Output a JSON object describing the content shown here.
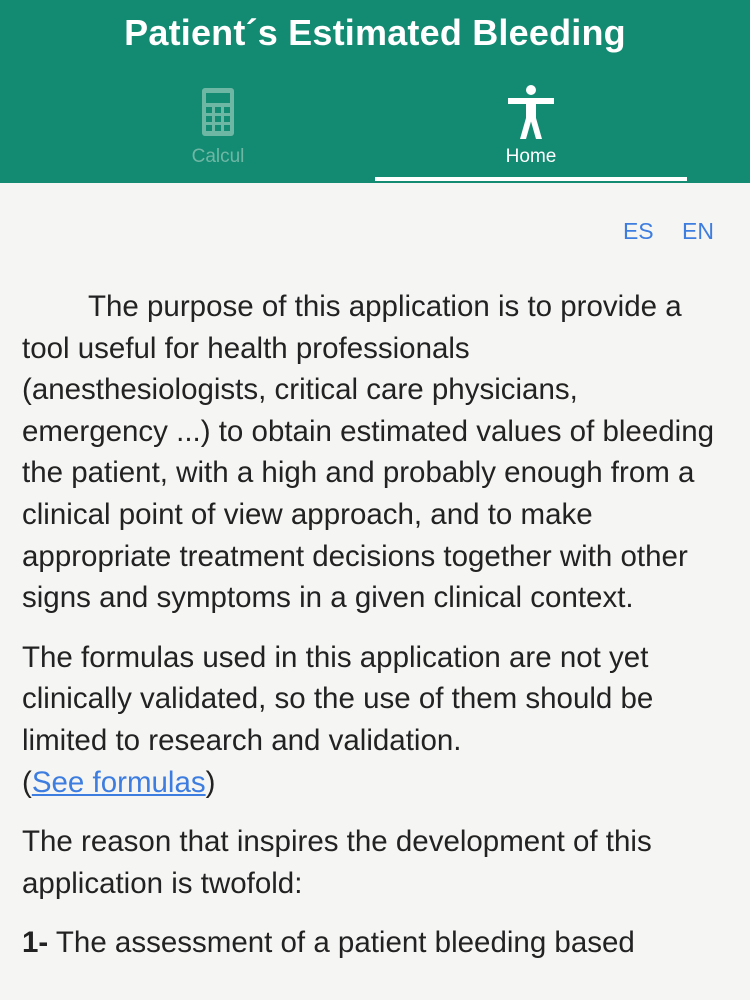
{
  "header": {
    "title": "Patient´s Estimated Bleeding",
    "tabs": [
      {
        "label": "Calcul",
        "icon": "calculator-icon"
      },
      {
        "label": "Home",
        "icon": "accessibility-person-icon"
      }
    ],
    "active_tab": "Home"
  },
  "language": {
    "es": "ES",
    "en": "EN"
  },
  "content": {
    "paragraph1": "The purpose of this application is to provide a tool useful for health professionals (anesthesiologists, critical care physicians, emergency ...) to obtain estimated values of bleeding the patient, with a high and probably enough from a clinical point of view approach, and to make appropriate treatment decisions together with other signs and symptoms in a given clinical context.",
    "paragraph2": "The formulas used in this application are not yet clinically validated, so the use of them should be limited to research and validation.",
    "paren_open": "(",
    "see_formulas": "See formulas",
    "paren_close": ")",
    "paragraph3": "The reason that inspires the development of this application is twofold:",
    "item1_number": "1-",
    "item1_text": " The assessment of a patient bleeding based"
  },
  "colors": {
    "header_bg": "#138a72",
    "link": "#3e7de0",
    "background": "#f5f5f3"
  }
}
